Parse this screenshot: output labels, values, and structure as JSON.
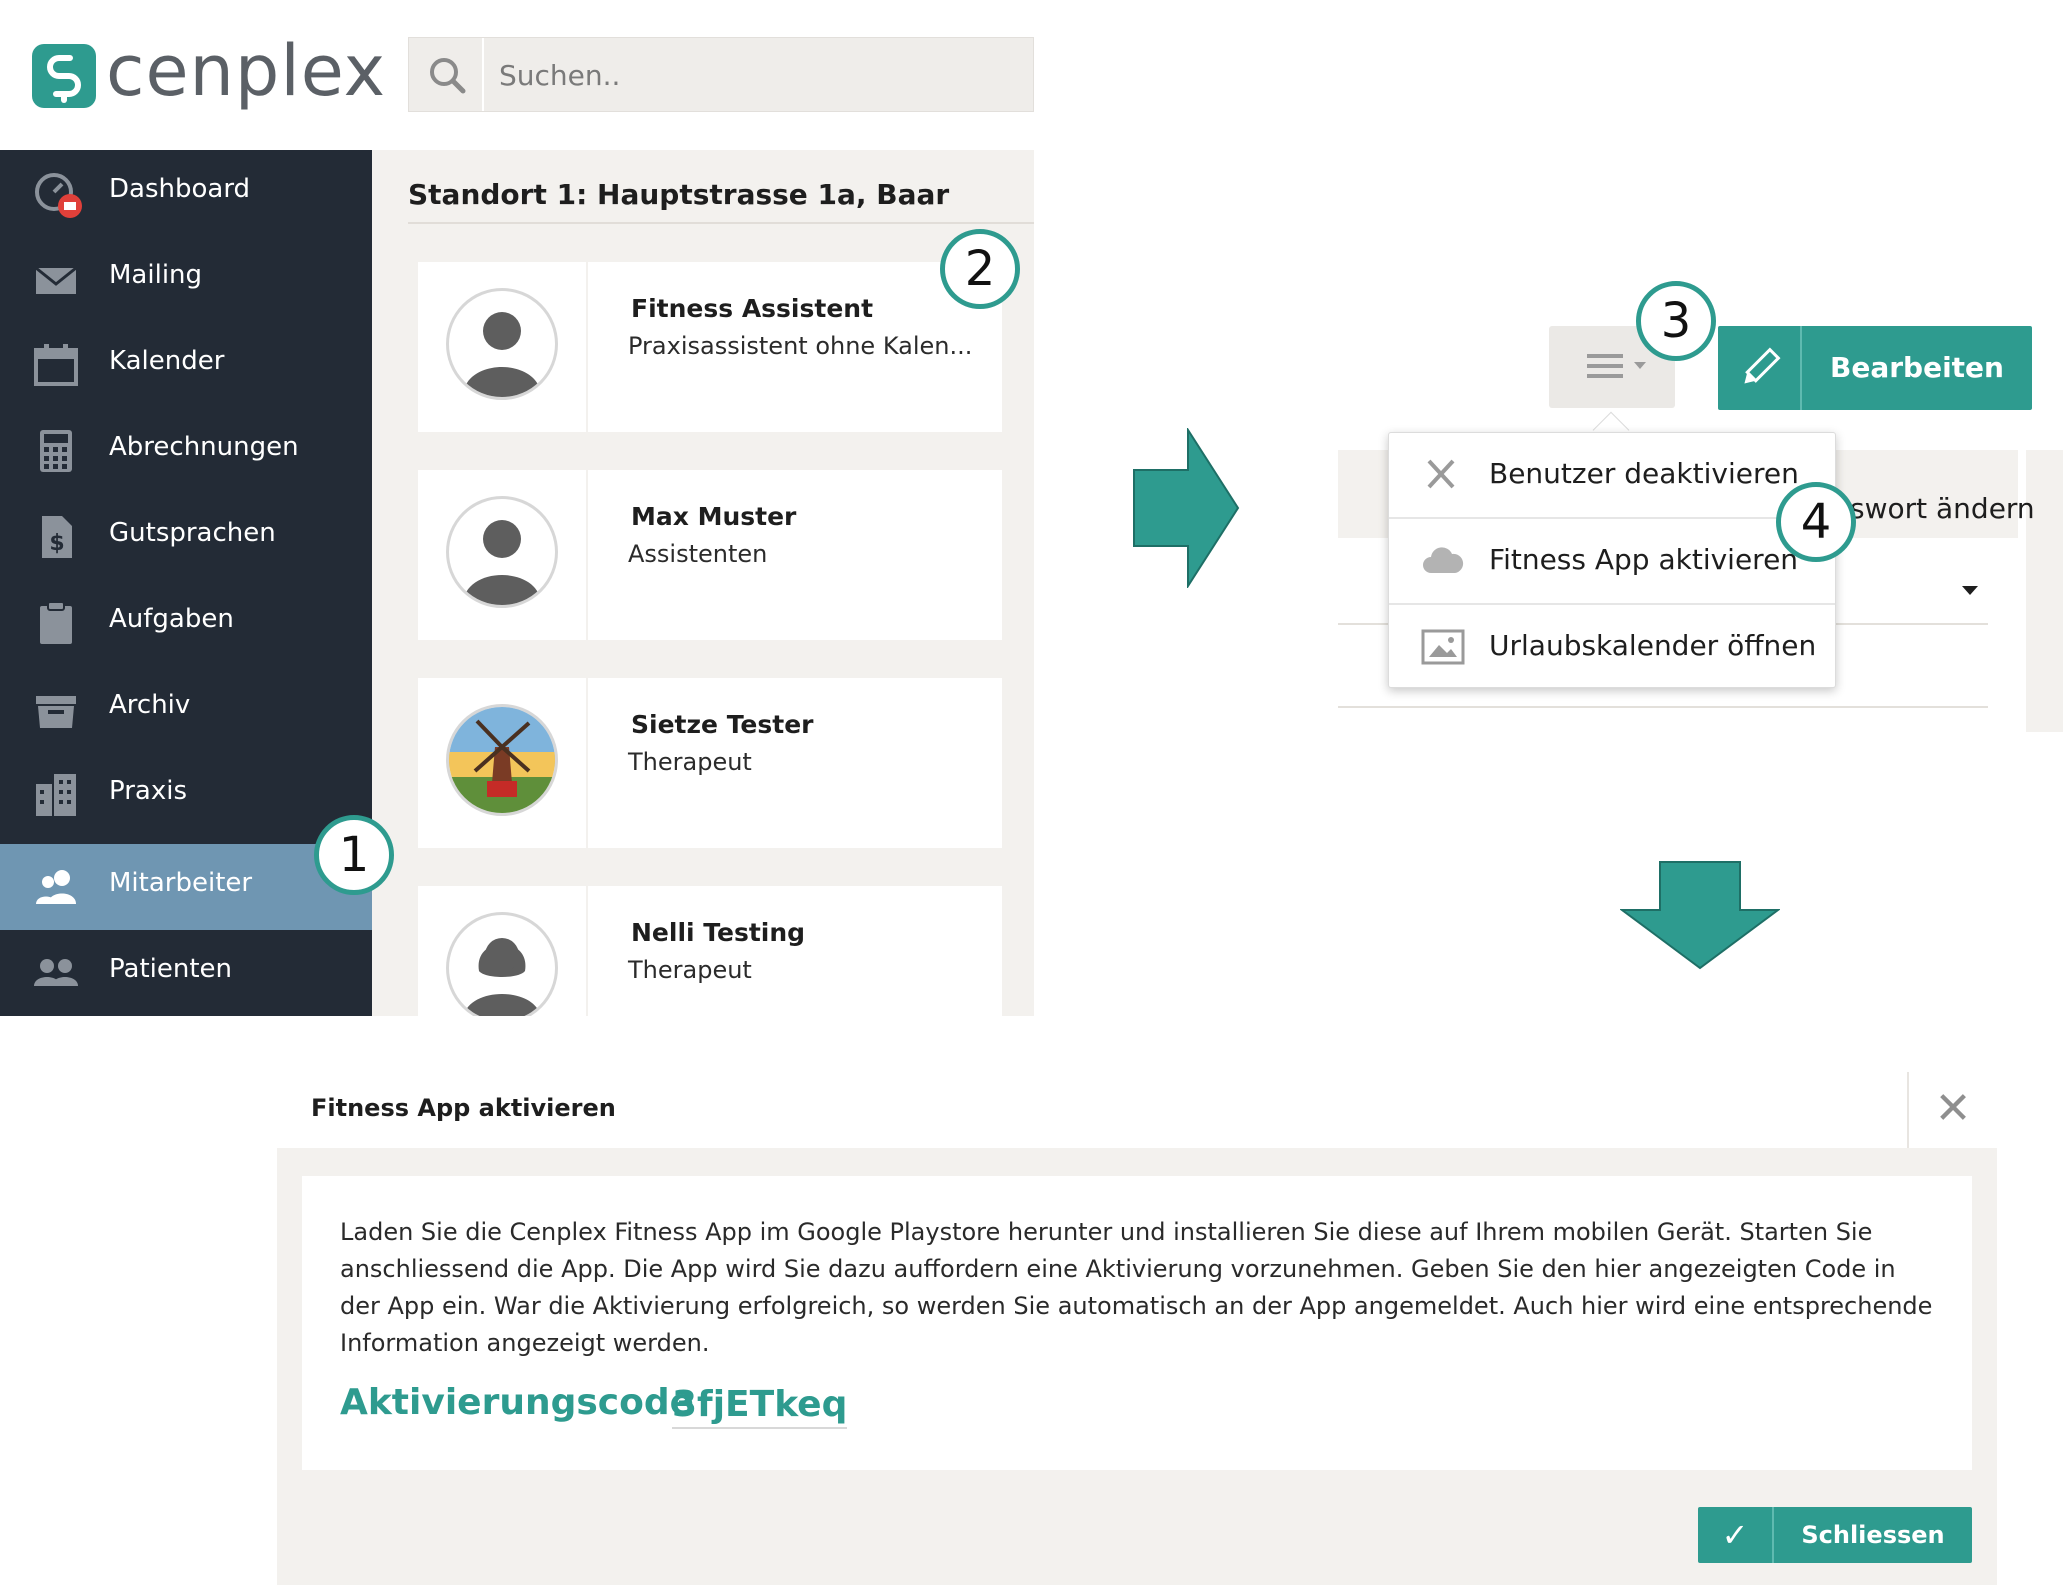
{
  "app": {
    "brand": "cenplex",
    "accent_color": "#2e9b8f",
    "sidebar_bg": "#232b36",
    "active_bg": "#6f96b2"
  },
  "search": {
    "placeholder": "Suchen.."
  },
  "sidebar": {
    "items": [
      {
        "label": "Dashboard",
        "icon": "dashboard-icon",
        "active": false
      },
      {
        "label": "Mailing",
        "icon": "mail-icon",
        "active": false
      },
      {
        "label": "Kalender",
        "icon": "calendar-icon",
        "active": false
      },
      {
        "label": "Abrechnungen",
        "icon": "calculator-icon",
        "active": false
      },
      {
        "label": "Gutsprachen",
        "icon": "money-document-icon",
        "active": false
      },
      {
        "label": "Aufgaben",
        "icon": "clipboard-icon",
        "active": false
      },
      {
        "label": "Archiv",
        "icon": "archive-icon",
        "active": false
      },
      {
        "label": "Praxis",
        "icon": "building-icon",
        "active": false
      },
      {
        "label": "Mitarbeiter",
        "icon": "staff-icon",
        "active": true
      },
      {
        "label": "Patienten",
        "icon": "patients-icon",
        "active": false
      }
    ]
  },
  "location": {
    "title": "Standort 1: Hauptstrasse 1a, Baar"
  },
  "staff": [
    {
      "name": "Fitness Assistent",
      "role": "Praxisassistent ohne Kalen...",
      "avatar": "male-silhouette-icon"
    },
    {
      "name": "Max Muster",
      "role": "Assistenten",
      "avatar": "male-silhouette-icon"
    },
    {
      "name": "Sietze Tester",
      "role": "Therapeut",
      "avatar": "windmill-photo"
    },
    {
      "name": "Nelli Testing",
      "role": "Therapeut",
      "avatar": "female-silhouette-icon"
    }
  ],
  "markers": [
    "1",
    "2",
    "3",
    "4"
  ],
  "toolbar": {
    "edit_label": "Bearbeiten",
    "behind_text": "swort ändern"
  },
  "dropdown": {
    "items": [
      {
        "label": "Benutzer deaktivieren",
        "icon": "x-icon"
      },
      {
        "label": "Fitness App aktivieren",
        "icon": "cloud-icon"
      },
      {
        "label": "Urlaubskalender öffnen",
        "icon": "image-icon"
      }
    ]
  },
  "modal": {
    "title": "Fitness App aktivieren",
    "close_symbol": "✕",
    "body": "Laden Sie die Cenplex Fitness App im Google Playstore herunter und installieren Sie diese auf Ihrem mobilen Gerät. Starten Sie anschliessend die App. Die App wird Sie dazu auffordern eine Aktivierung vorzunehmen. Geben Sie den hier angezeigten Code in der App ein. War die Aktivierung erfolgreich, so werden Sie automatisch an der App angemeldet. Auch hier wird eine entsprechende Information angezeigt werden.",
    "code_label": "Aktivierungscode",
    "code_value": "3fjETkeq",
    "button_check": "✓",
    "button_label": "Schliessen"
  }
}
